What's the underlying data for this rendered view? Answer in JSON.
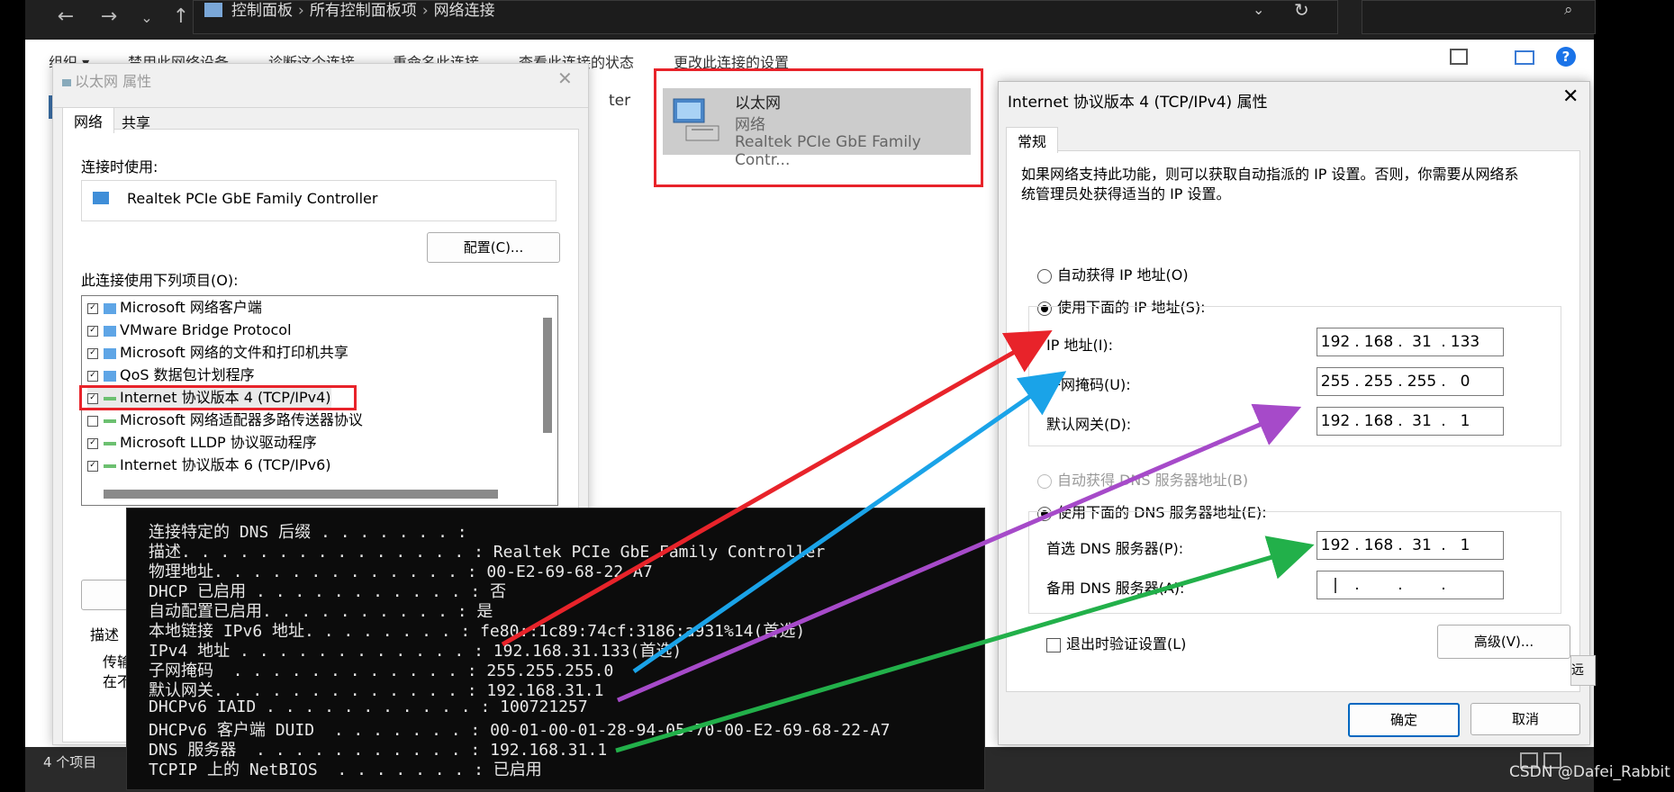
{
  "explorer": {
    "breadcrumbs": [
      "控制面板",
      "所有控制面板项",
      "网络连接"
    ],
    "commands": [
      "组织 ▾",
      "禁用此网络设备",
      "诊断这个连接",
      "重命名此连接",
      "查看此连接的状态",
      "更改此连接的设置"
    ],
    "status_text": "4 个项目",
    "partial_text": "ter"
  },
  "adapter": {
    "name": "以太网",
    "type": "网络",
    "device": "Realtek PCIe GbE Family Contr..."
  },
  "properties_dialog": {
    "title": "以太网 属性",
    "tabs": [
      "网络",
      "共享"
    ],
    "connect_using_label": "连接时使用:",
    "adapter_name": "Realtek PCIe GbE Family Controller",
    "configure_button": "配置(C)...",
    "items_label": "此连接使用下列项目(O):",
    "items": [
      {
        "label": "Microsoft 网络客户端",
        "checked": true
      },
      {
        "label": "VMware Bridge Protocol",
        "checked": true
      },
      {
        "label": "Microsoft 网络的文件和打印机共享",
        "checked": true
      },
      {
        "label": "QoS 数据包计划程序",
        "checked": true
      },
      {
        "label": "Internet 协议版本 4 (TCP/IPv4)",
        "checked": true
      },
      {
        "label": "Microsoft 网络适配器多路传送器协议",
        "checked": false
      },
      {
        "label": "Microsoft LLDP 协议驱动程序",
        "checked": true
      },
      {
        "label": "Internet 协议版本 6 (TCP/IPv6)",
        "checked": true
      }
    ],
    "description_label": "描述",
    "desc_line1": "传输",
    "desc_line2": "在不"
  },
  "ipv4_dialog": {
    "title": "Internet 协议版本 4 (TCP/IPv4) 属性",
    "tab": "常规",
    "intro_line1": "如果网络支持此功能，则可以获取自动指派的 IP 设置。否则，你需要从网络系",
    "intro_line2": "统管理员处获得适当的 IP 设置。",
    "auto_ip": "自动获得 IP 地址(O)",
    "manual_ip": "使用下面的 IP 地址(S):",
    "ip_label": "IP 地址(I):",
    "ip": [
      "192",
      "168",
      "31",
      "133"
    ],
    "mask_label": "子网掩码(U):",
    "mask": [
      "255",
      "255",
      "255",
      "0"
    ],
    "gateway_label": "默认网关(D):",
    "gateway": [
      "192",
      "168",
      "31",
      "1"
    ],
    "auto_dns": "自动获得 DNS 服务器地址(B)",
    "manual_dns": "使用下面的 DNS 服务器地址(E):",
    "pref_dns_label": "首选 DNS 服务器(P):",
    "pref_dns": [
      "192",
      "168",
      "31",
      "1"
    ],
    "alt_dns_label": "备用 DNS 服务器(A):",
    "validate_label": "退出时验证设置(L)",
    "advanced_button": "高级(V)...",
    "ok_button": "确定",
    "cancel_button": "取消",
    "side_tab": "远程"
  },
  "console": {
    "lines": [
      "连接特定的 DNS 后缀 . . . . . . . :",
      "描述. . . . . . . . . . . . . . . : Realtek PCIe GbE Family Controller",
      "物理地址. . . . . . . . . . . . . : 00-E2-69-68-22-A7",
      "DHCP 已启用 . . . . . . . . . . . : 否",
      "自动配置已启用. . . . . . . . . . : 是",
      "本地链接 IPv6 地址. . . . . . . . : fe80::1c89:74cf:3186:a931%14(首选)",
      "IPv4 地址 . . . . . . . . . . . . : 192.168.31.133(首选)",
      "子网掩码  . . . . . . . . . . . . : 255.255.255.0",
      "默认网关. . . . . . . . . . . . . : 192.168.31.1",
      "DHCPv6 IAID . . . . . . . . . . . : 100721257",
      "DHCPv6 客户端 DUID  . . . . . . . : 00-01-00-01-28-94-05-70-00-E2-69-68-22-A7",
      "DNS 服务器  . . . . . . . . . . . : 192.168.31.1",
      "TCPIP 上的 NetBIOS  . . . . . . . : 已启用"
    ]
  },
  "watermark": "CSDN @Dafei_Rabbit",
  "colors": {
    "highlight_red": "#e8232a",
    "arrow_red": "#e8232a",
    "arrow_blue": "#1aa3e8",
    "arrow_purple": "#a64ac9",
    "arrow_green": "#22b04a"
  }
}
